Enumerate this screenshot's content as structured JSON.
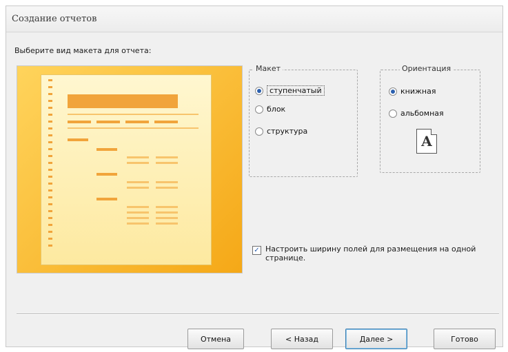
{
  "window": {
    "title": "Создание отчетов"
  },
  "prompt": "Выберите вид макета для отчета:",
  "layout_group": {
    "title": "Макет",
    "options": [
      {
        "label": "ступенчатый",
        "selected": true
      },
      {
        "label": "блок",
        "selected": false
      },
      {
        "label": "структура",
        "selected": false
      }
    ]
  },
  "orientation_group": {
    "title": "Ориентация",
    "options": [
      {
        "label": "книжная",
        "selected": true
      },
      {
        "label": "альбомная",
        "selected": false
      }
    ],
    "icon_letter": "A"
  },
  "fit_checkbox": {
    "label": "Настроить ширину полей для размещения на одной странице.",
    "checked": true
  },
  "buttons": {
    "cancel": "Отмена",
    "back": "< Назад",
    "next": "Далее >",
    "finish": "Готово"
  },
  "colors": {
    "preview_accent": "#f5a817",
    "sheet_mark": "#f1a43b"
  }
}
